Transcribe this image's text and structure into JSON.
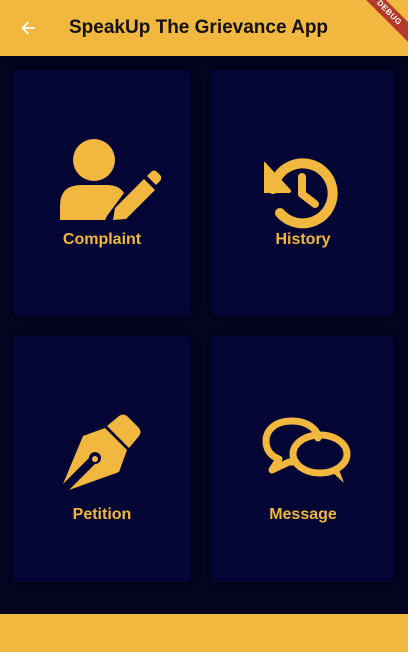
{
  "app": {
    "title": "SpeakUp The Grievance App",
    "debug_banner": "DEBUG"
  },
  "colors": {
    "accent": "#f1b73f",
    "background": "#020420",
    "card": "#030634"
  },
  "appbar": {
    "back_icon": "arrow-left-icon"
  },
  "menu": [
    {
      "label": "Complaint",
      "icon": "user-edit-icon"
    },
    {
      "label": "History",
      "icon": "history-icon"
    },
    {
      "label": "Petition",
      "icon": "pen-nib-icon"
    },
    {
      "label": "Message",
      "icon": "comments-icon"
    }
  ]
}
